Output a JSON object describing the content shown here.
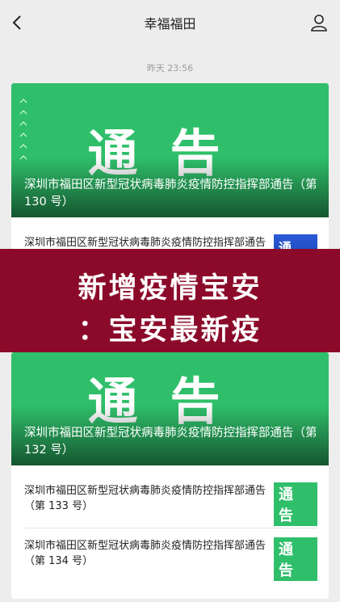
{
  "header": {
    "title": "幸福福田"
  },
  "timestamp": "昨天 23:56",
  "cover_label": "通告",
  "articles": [
    {
      "title": "深圳市福田区新型冠状病毒肺炎疫情防控指挥部通告（第 130 号）"
    },
    {
      "title": "深圳市福田区新型冠状病毒肺炎疫情防控指挥部通告（第 131 号）",
      "thumb": "通告"
    },
    {
      "title": "深圳市福田区新型冠状病毒肺炎疫情防控指挥部通告（第 132 号）"
    },
    {
      "title": "深圳市福田区新型冠状病毒肺炎疫情防控指挥部通告（第 133 号）",
      "thumb": "通 告"
    },
    {
      "title": "深圳市福田区新型冠状病毒肺炎疫情防控指挥部通告（第 134 号）",
      "thumb": "通 告"
    }
  ],
  "banner": {
    "line1": "新增疫情宝安",
    "line2": "：宝安最新疫"
  },
  "colors": {
    "cover_green": "#2fbf6a",
    "banner_red": "#8b0a2a",
    "background": "#ededed"
  }
}
